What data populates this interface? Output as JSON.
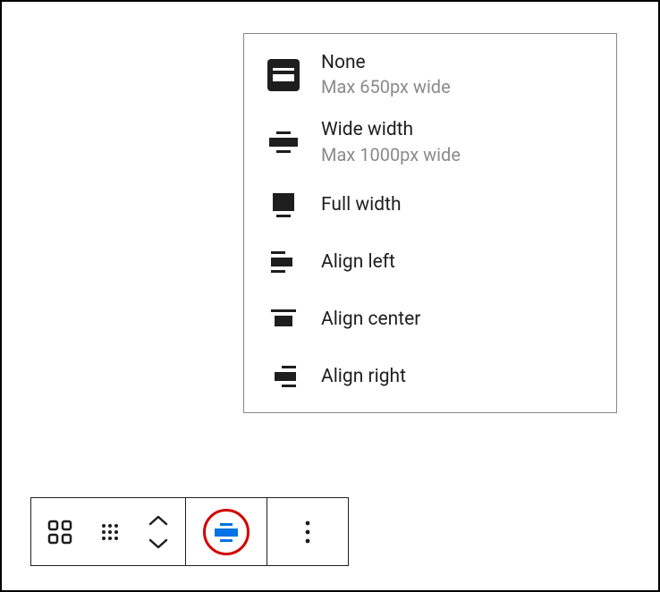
{
  "menu": {
    "items": [
      {
        "label": "None",
        "sub": "Max 650px wide",
        "icon": "align-none-icon"
      },
      {
        "label": "Wide width",
        "sub": "Max 1000px wide",
        "icon": "align-wide-icon"
      },
      {
        "label": "Full width",
        "sub": "",
        "icon": "align-full-icon"
      },
      {
        "label": "Align left",
        "sub": "",
        "icon": "align-left-icon"
      },
      {
        "label": "Align center",
        "sub": "",
        "icon": "align-center-icon"
      },
      {
        "label": "Align right",
        "sub": "",
        "icon": "align-right-icon"
      }
    ]
  },
  "toolbar": {
    "block_type_icon": "grid-icon",
    "drag_icon": "drag-handle-icon",
    "move_up_icon": "chevron-up-icon",
    "move_down_icon": "chevron-down-icon",
    "align_icon": "align-wide-active-icon",
    "more_icon": "more-vertical-icon"
  }
}
